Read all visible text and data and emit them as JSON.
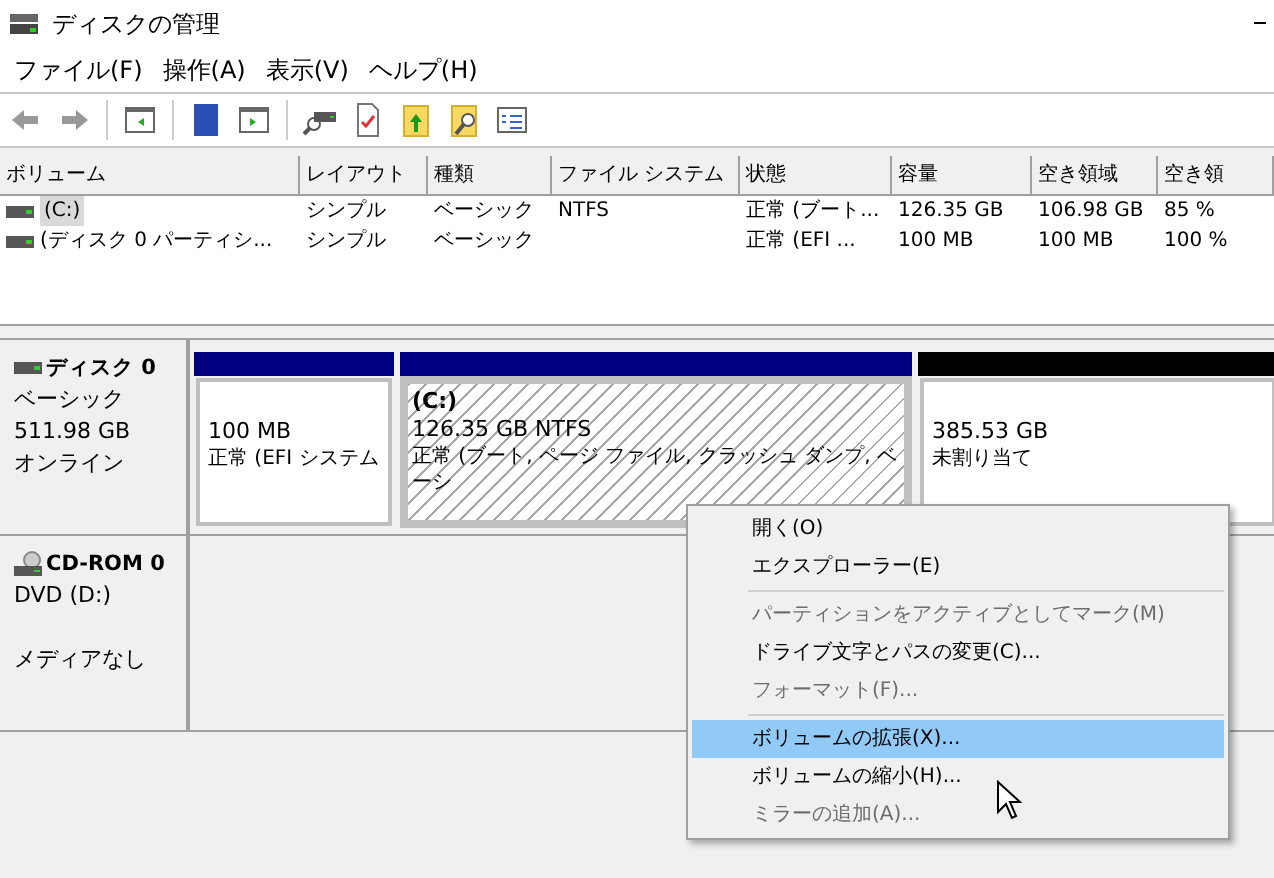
{
  "window": {
    "title": "ディスクの管理"
  },
  "menu_bar": [
    "ファイル(F)",
    "操作(A)",
    "表示(V)",
    "ヘルプ(H)"
  ],
  "table": {
    "columns": [
      "ボリューム",
      "レイアウト",
      "種類",
      "ファイル システム",
      "状態",
      "容量",
      "空き領域",
      "空き領"
    ],
    "rows": [
      {
        "selected": true,
        "cells": [
          "(C:)",
          "シンプル",
          "ベーシック",
          "NTFS",
          "正常 (ブート...",
          "126.35 GB",
          "106.98 GB",
          "85 %"
        ]
      },
      {
        "selected": false,
        "cells": [
          "(ディスク 0 パーティシ...",
          "シンプル",
          "ベーシック",
          "",
          "正常 (EFI ...",
          "100 MB",
          "100 MB",
          "100 %"
        ]
      }
    ]
  },
  "disks": [
    {
      "kind": "disk",
      "name": "ディスク 0",
      "lines": [
        "ベーシック",
        "511.98 GB",
        "オンライン"
      ],
      "partitions": [
        {
          "kind": "primary",
          "selected": false,
          "size": "100 MB",
          "status": "正常 (EFI システム"
        },
        {
          "kind": "primary",
          "selected": true,
          "label": "(C:)",
          "size": "126.35 GB NTFS",
          "status": "正常 (ブート, ページ ファイル, クラッシュ ダンプ, ベーシ"
        },
        {
          "kind": "unallocated",
          "selected": false,
          "size": "385.53 GB",
          "status": "未割り当て"
        }
      ]
    },
    {
      "kind": "cdrom",
      "name": "CD-ROM 0",
      "lines": [
        "DVD (D:)",
        "メディアなし"
      ]
    }
  ],
  "context_menu": [
    {
      "kind": "item",
      "label": "開く(O)",
      "disabled": false,
      "selected": false
    },
    {
      "kind": "item",
      "label": "エクスプローラー(E)",
      "disabled": false,
      "selected": false
    },
    {
      "kind": "separator"
    },
    {
      "kind": "item",
      "label": "パーティションをアクティブとしてマーク(M)",
      "disabled": true,
      "selected": false
    },
    {
      "kind": "item",
      "label": "ドライブ文字とパスの変更(C)...",
      "disabled": false,
      "selected": false
    },
    {
      "kind": "item",
      "label": "フォーマット(F)...",
      "disabled": true,
      "selected": false
    },
    {
      "kind": "separator"
    },
    {
      "kind": "item",
      "label": "ボリュームの拡張(X)...",
      "disabled": false,
      "selected": true
    },
    {
      "kind": "item",
      "label": "ボリュームの縮小(H)...",
      "disabled": false,
      "selected": false
    },
    {
      "kind": "item",
      "label": "ミラーの追加(A)...",
      "disabled": true,
      "selected": false
    }
  ]
}
